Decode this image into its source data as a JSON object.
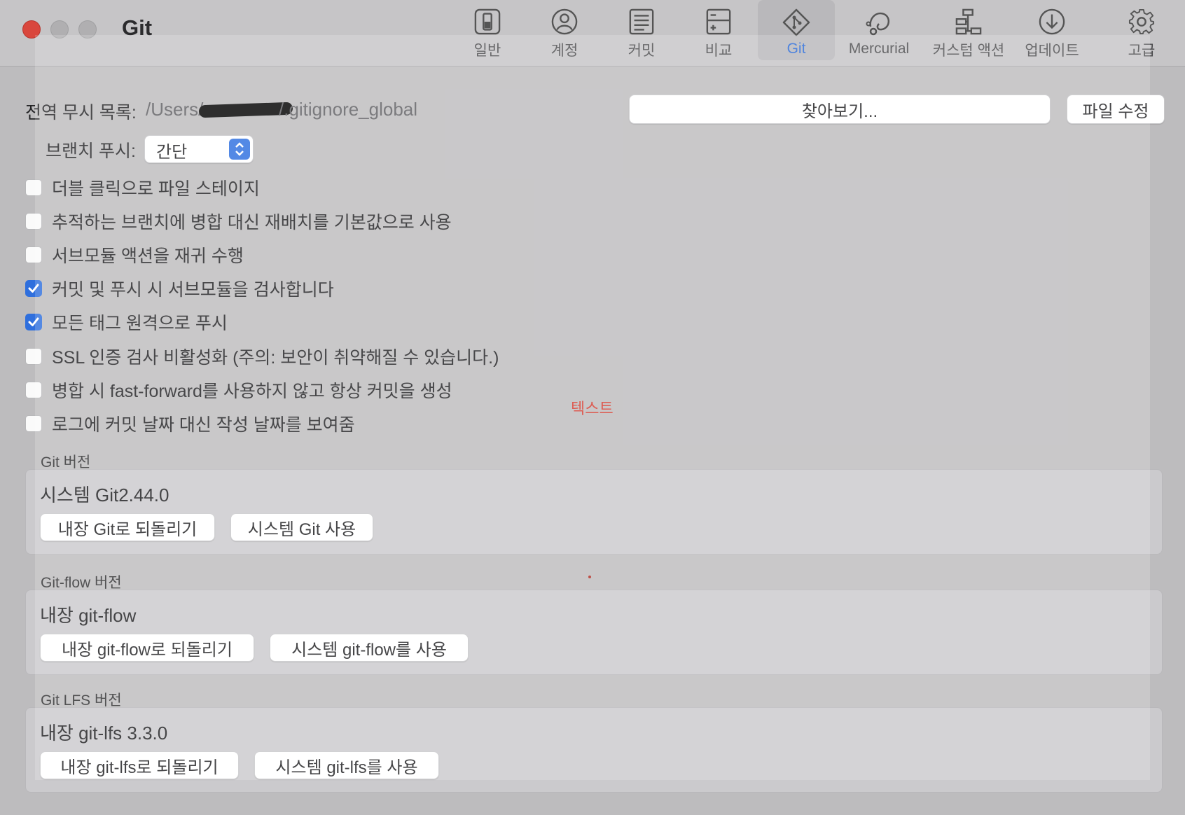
{
  "window": {
    "title": "Git"
  },
  "toolbar": {
    "items": [
      {
        "label": "일반",
        "icon": "general-icon"
      },
      {
        "label": "계정",
        "icon": "account-icon"
      },
      {
        "label": "커밋",
        "icon": "commit-icon"
      },
      {
        "label": "비교",
        "icon": "diff-icon"
      },
      {
        "label": "Git",
        "icon": "git-icon",
        "selected": true
      },
      {
        "label": "Mercurial",
        "icon": "mercurial-icon"
      },
      {
        "label": "커스텀 액션",
        "icon": "custom-actions-icon"
      },
      {
        "label": "업데이트",
        "icon": "update-icon"
      },
      {
        "label": "고급",
        "icon": "gear-icon"
      }
    ]
  },
  "global_ignore": {
    "label": "전역 무시 목록:",
    "path_prefix": "/Users/",
    "path_suffix": "/.gitignore_global",
    "browse_button": "찾아보기...",
    "edit_button": "파일 수정"
  },
  "branch_push": {
    "label": "브랜치 푸시:",
    "value": "간단"
  },
  "options": [
    {
      "label": "더블 클릭으로 파일 스테이지",
      "checked": false
    },
    {
      "label": "추적하는 브랜치에 병합 대신 재배치를 기본값으로 사용",
      "checked": false
    },
    {
      "label": "서브모듈 액션을 재귀 수행",
      "checked": false
    },
    {
      "label": "커밋 및 푸시 시 서브모듈을 검사합니다",
      "checked": true
    },
    {
      "label": "모든 태그 원격으로 푸시",
      "checked": true
    },
    {
      "label": "SSL 인증 검사 비활성화 (주의: 보안이 취약해질 수 있습니다.)",
      "checked": false
    },
    {
      "label": "병합 시 fast-forward를 사용하지 않고 항상 커밋을 생성",
      "checked": false
    },
    {
      "label": "로그에 커밋 날짜 대신 작성 날짜를 보여줌",
      "checked": false
    }
  ],
  "annotation": {
    "text": "텍스트",
    "color": "#d63a2e"
  },
  "git_version": {
    "title": "Git 버전",
    "value": "시스템 Git2.44.0",
    "revert_button": "내장 Git로 되돌리기",
    "system_button": "시스템 Git 사용"
  },
  "gitflow_version": {
    "title": "Git-flow 버전",
    "value": "내장 git-flow",
    "revert_button": "내장 git-flow로 되돌리기",
    "system_button": "시스템 git-flow를 사용"
  },
  "gitlfs_version": {
    "title": "Git LFS 버전",
    "value": "내장 git-lfs 3.3.0",
    "revert_button": "내장 git-lfs로 되돌리기",
    "system_button": "시스템 git-lfs를 사용"
  },
  "colors": {
    "accent": "#2f6fdd",
    "close": "#d9473d",
    "annotation_box": "#a8281f"
  }
}
